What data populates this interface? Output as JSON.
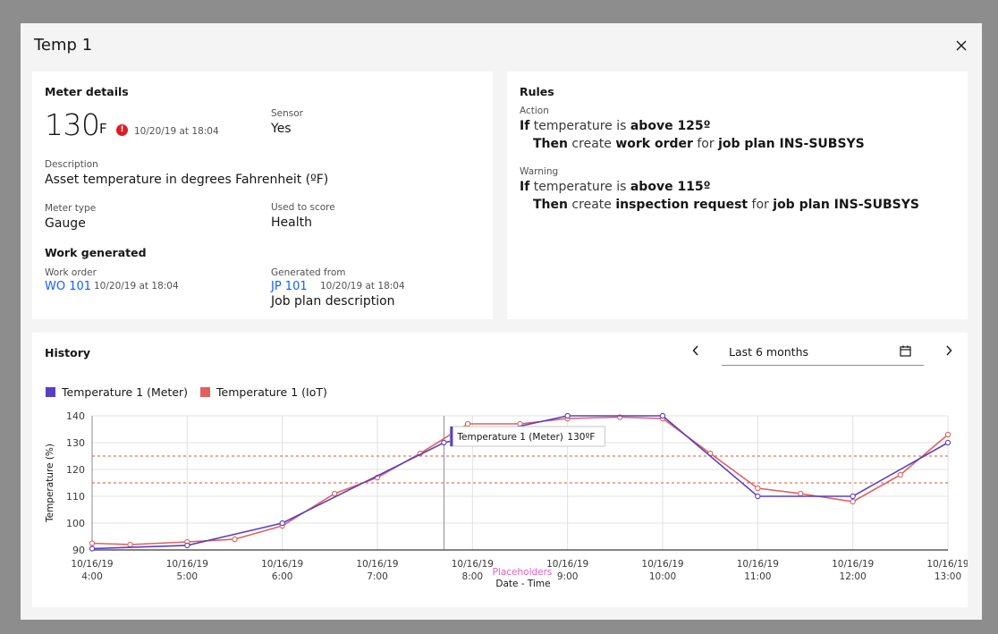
{
  "modal": {
    "title": "Temp 1"
  },
  "meter": {
    "section_title": "Meter details",
    "value": "130",
    "unit": "F",
    "timestamp": "10/20/19 at 18:04",
    "sensor_label": "Sensor",
    "sensor_value": "Yes",
    "description_label": "Description",
    "description_value": "Asset temperature in degrees Fahrenheit (ºF)",
    "meter_type_label": "Meter type",
    "meter_type_value": "Gauge",
    "used_to_score_label": "Used to score",
    "used_to_score_value": "Health",
    "work_title": "Work generated",
    "work_order_label": "Work order",
    "work_order_link": "WO 101",
    "work_order_ts": "10/20/19 at 18:04",
    "generated_from_label": "Generated from",
    "generated_from_link": "JP 101",
    "generated_from_ts": "10/20/19 at 18:04",
    "job_plan_desc": "Job plan description"
  },
  "rules": {
    "section_title": "Rules",
    "items": [
      {
        "label": "Action",
        "if_word": "If",
        "if_text": " temperature is ",
        "if_bold": "above 125º",
        "then_word": "Then",
        "then_text1": " create ",
        "then_bold1": "work order",
        "then_text2": " for ",
        "then_bold2": "job plan INS-SUBSYS"
      },
      {
        "label": "Warning",
        "if_word": "If",
        "if_text": " temperature is ",
        "if_bold": "above 115º",
        "then_word": "Then",
        "then_text1": " create ",
        "then_bold1": "inspection request",
        "then_text2": " for ",
        "then_bold2": "job plan INS-SUBSYS"
      }
    ]
  },
  "history": {
    "section_title": "History",
    "range_label": "Last 6 months",
    "tooltip_series": "Temperature 1 (Meter)",
    "tooltip_value": "130ºF",
    "placeholder_text": "Placeholders"
  },
  "colors": {
    "meter": "#5a3fc0",
    "iot": "#e06060",
    "link": "#0f62fe",
    "error": "#da1e28",
    "threshold": "#e0552f"
  },
  "icons": {
    "close": "close-icon",
    "error": "error-icon",
    "calendar": "calendar-icon",
    "prev": "chevron-left-icon",
    "next": "chevron-right-icon"
  },
  "chart_data": {
    "type": "line",
    "title": "",
    "xlabel": "Date - Time",
    "ylabel": "Temperature (%)",
    "ylim": [
      90,
      140
    ],
    "yticks": [
      90,
      100,
      110,
      120,
      130,
      140
    ],
    "xticks": [
      {
        "x": 4.0,
        "date": "10/16/19",
        "time": "4:00"
      },
      {
        "x": 5.0,
        "date": "10/16/19",
        "time": "5:00"
      },
      {
        "x": 6.0,
        "date": "10/16/19",
        "time": "6:00"
      },
      {
        "x": 7.0,
        "date": "10/16/19",
        "time": "7:00"
      },
      {
        "x": 8.0,
        "date": "10/16/19",
        "time": "8:00"
      },
      {
        "x": 9.0,
        "date": "10/16/19",
        "time": "9:00"
      },
      {
        "x": 10.0,
        "date": "10/16/19",
        "time": "10:00"
      },
      {
        "x": 11.0,
        "date": "10/16/19",
        "time": "11:00"
      },
      {
        "x": 12.0,
        "date": "10/16/19",
        "time": "12:00"
      },
      {
        "x": 13.0,
        "date": "10/16/19",
        "time": "13:00"
      }
    ],
    "xlim": [
      4.0,
      13.0
    ],
    "grid": true,
    "legend": "top-left",
    "thresholds": [
      125,
      115
    ],
    "cursor_x": 7.7,
    "series": [
      {
        "name": "Temperature 1 (Meter)",
        "color": "#5a3fc0",
        "x": [
          4.0,
          5.0,
          6.0,
          7.7,
          9.0,
          10.0,
          11.0,
          12.0,
          13.0
        ],
        "y": [
          90.5,
          91.7,
          100,
          130,
          140,
          140,
          110,
          110,
          130
        ]
      },
      {
        "name": "Temperature 1 (IoT)",
        "color": "#e06060",
        "x": [
          4.0,
          4.4,
          5.0,
          5.5,
          6.0,
          6.55,
          7.0,
          7.45,
          7.95,
          8.5,
          9.0,
          9.55,
          10.0,
          10.5,
          11.0,
          11.45,
          12.0,
          12.5,
          13.0
        ],
        "y": [
          92.5,
          92,
          93,
          94,
          99,
          111,
          117,
          126,
          137,
          137,
          139,
          139.5,
          139,
          126,
          113,
          111,
          108,
          118,
          133
        ]
      }
    ]
  }
}
